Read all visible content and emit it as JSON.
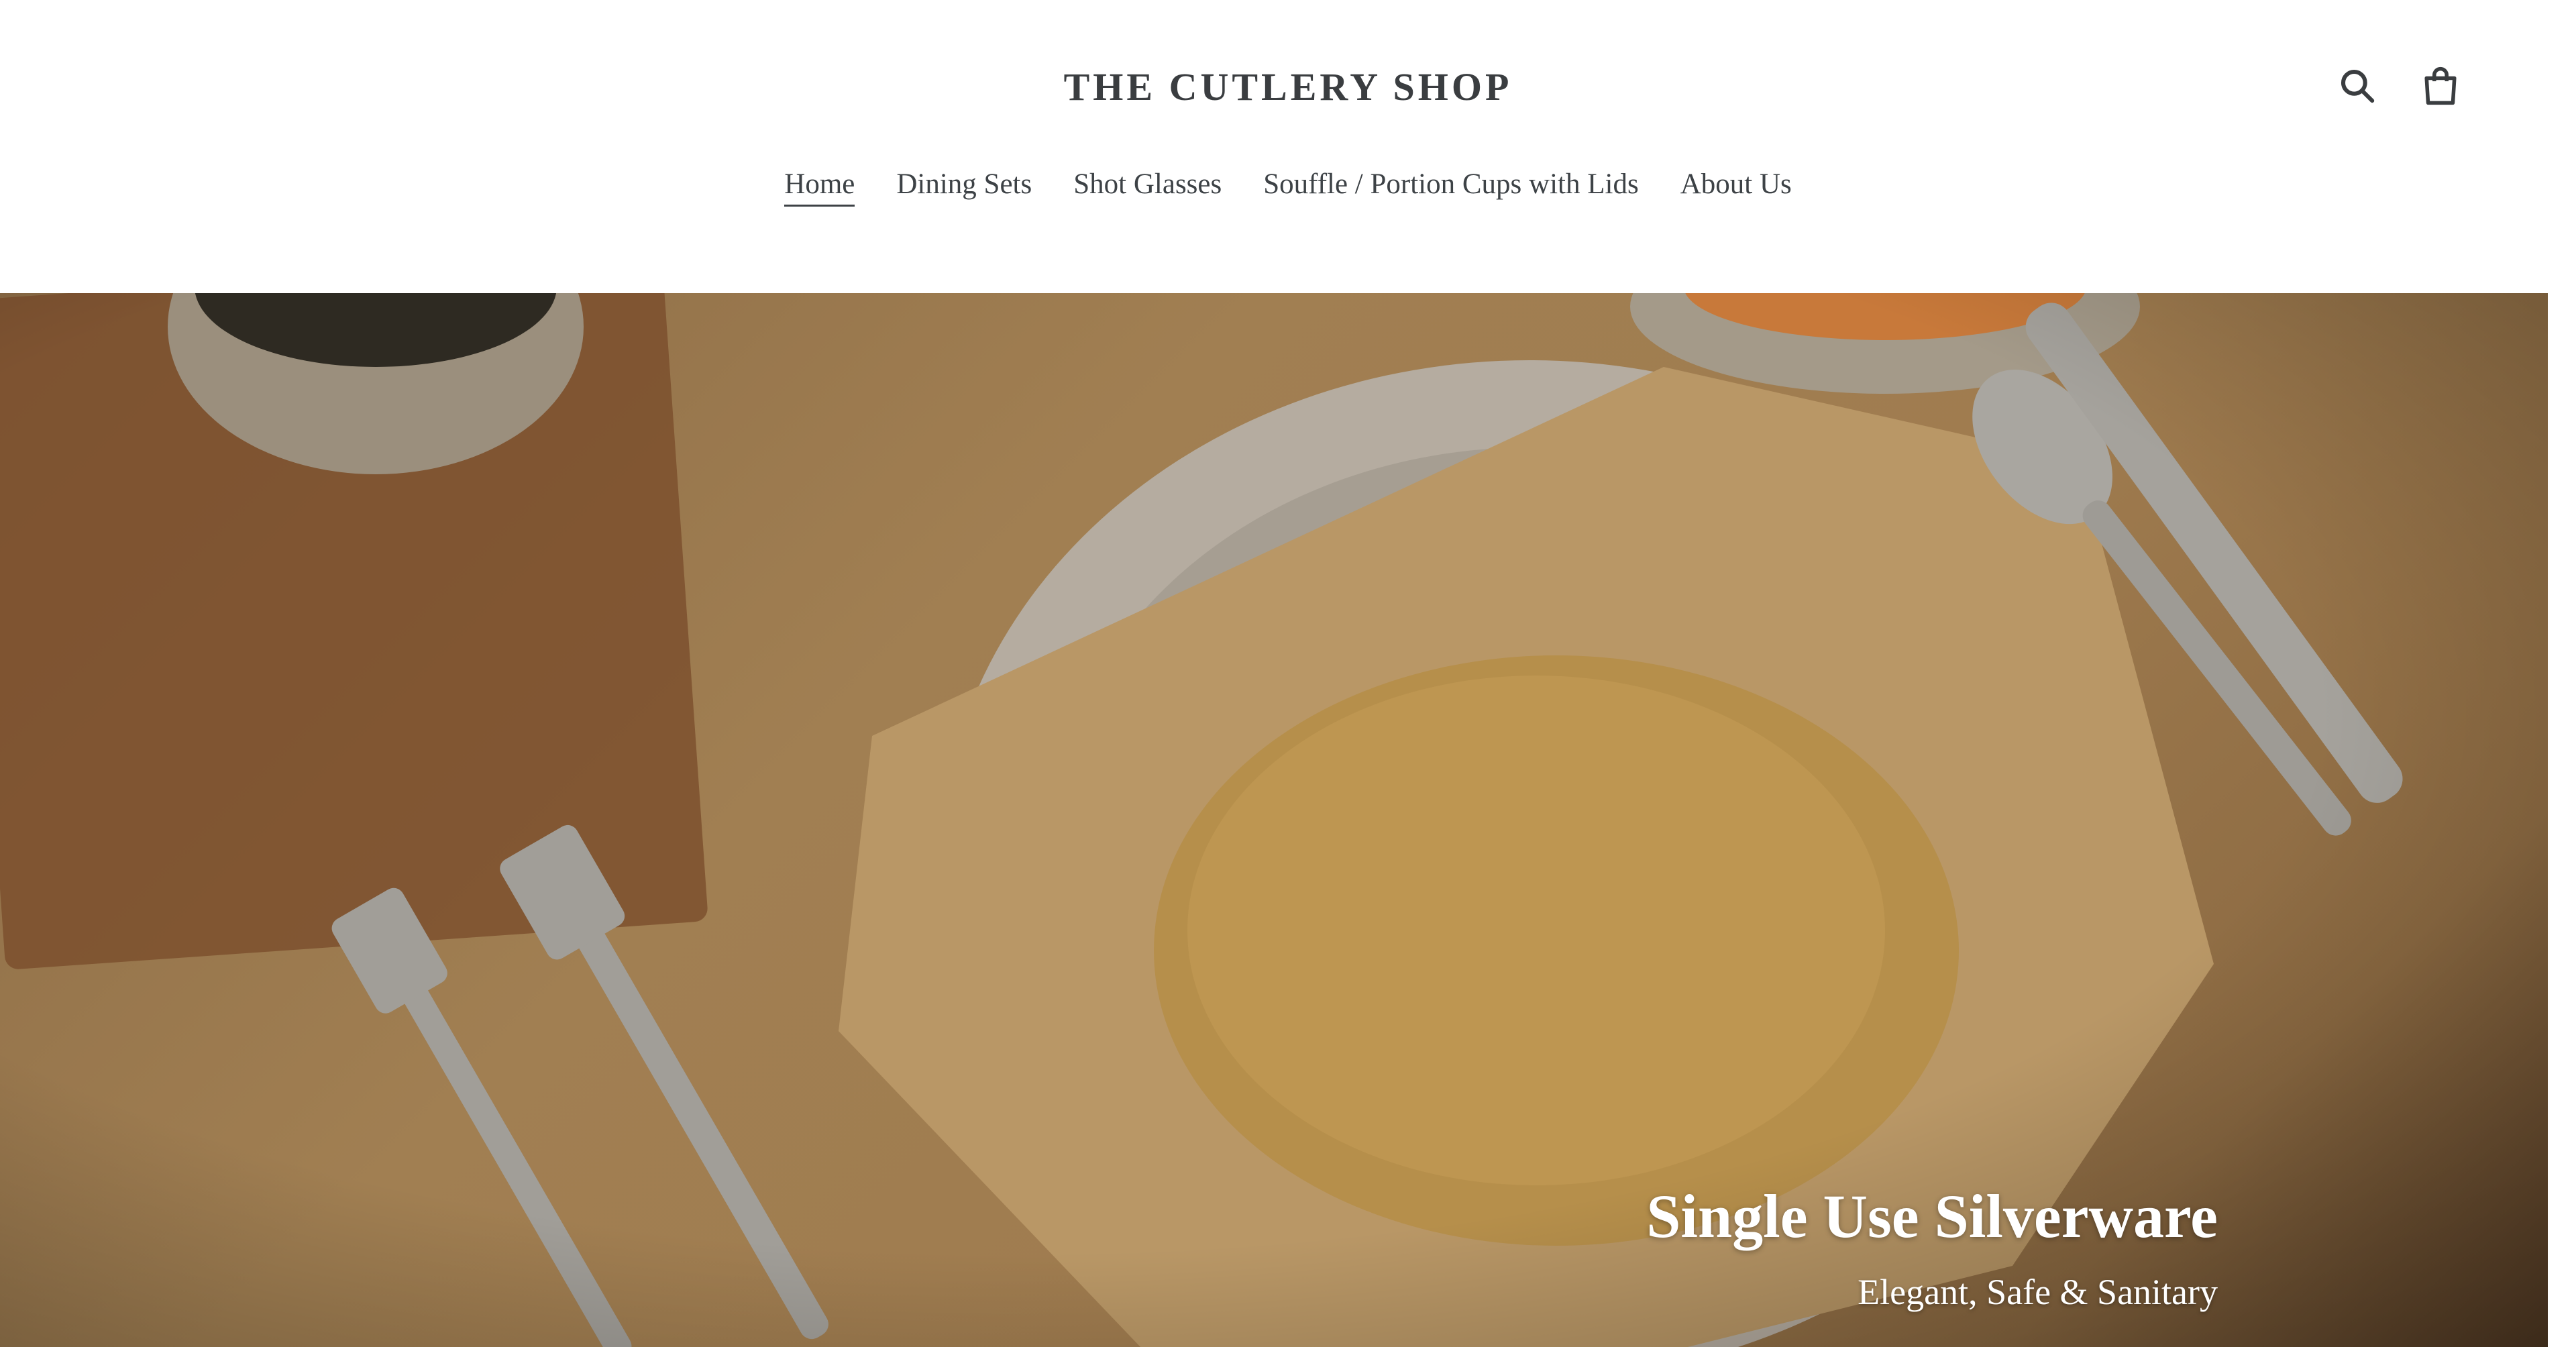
{
  "header": {
    "brand": "THE CUTLERY SHOP",
    "icons": [
      "search-icon",
      "cart-icon"
    ]
  },
  "nav": {
    "items": [
      {
        "label": "Home",
        "active": true
      },
      {
        "label": "Dining Sets"
      },
      {
        "label": "Shot Glasses"
      },
      {
        "label": "Souffle / Portion Cups with Lids"
      },
      {
        "label": "About Us"
      }
    ]
  },
  "hero": {
    "title": "Single Use Silverware",
    "subtitle": "Elegant, Safe & Sanitary"
  },
  "colors": {
    "text": "#3d4246",
    "hero_tone": "#a17f52",
    "hero_text": "#ffffff"
  }
}
